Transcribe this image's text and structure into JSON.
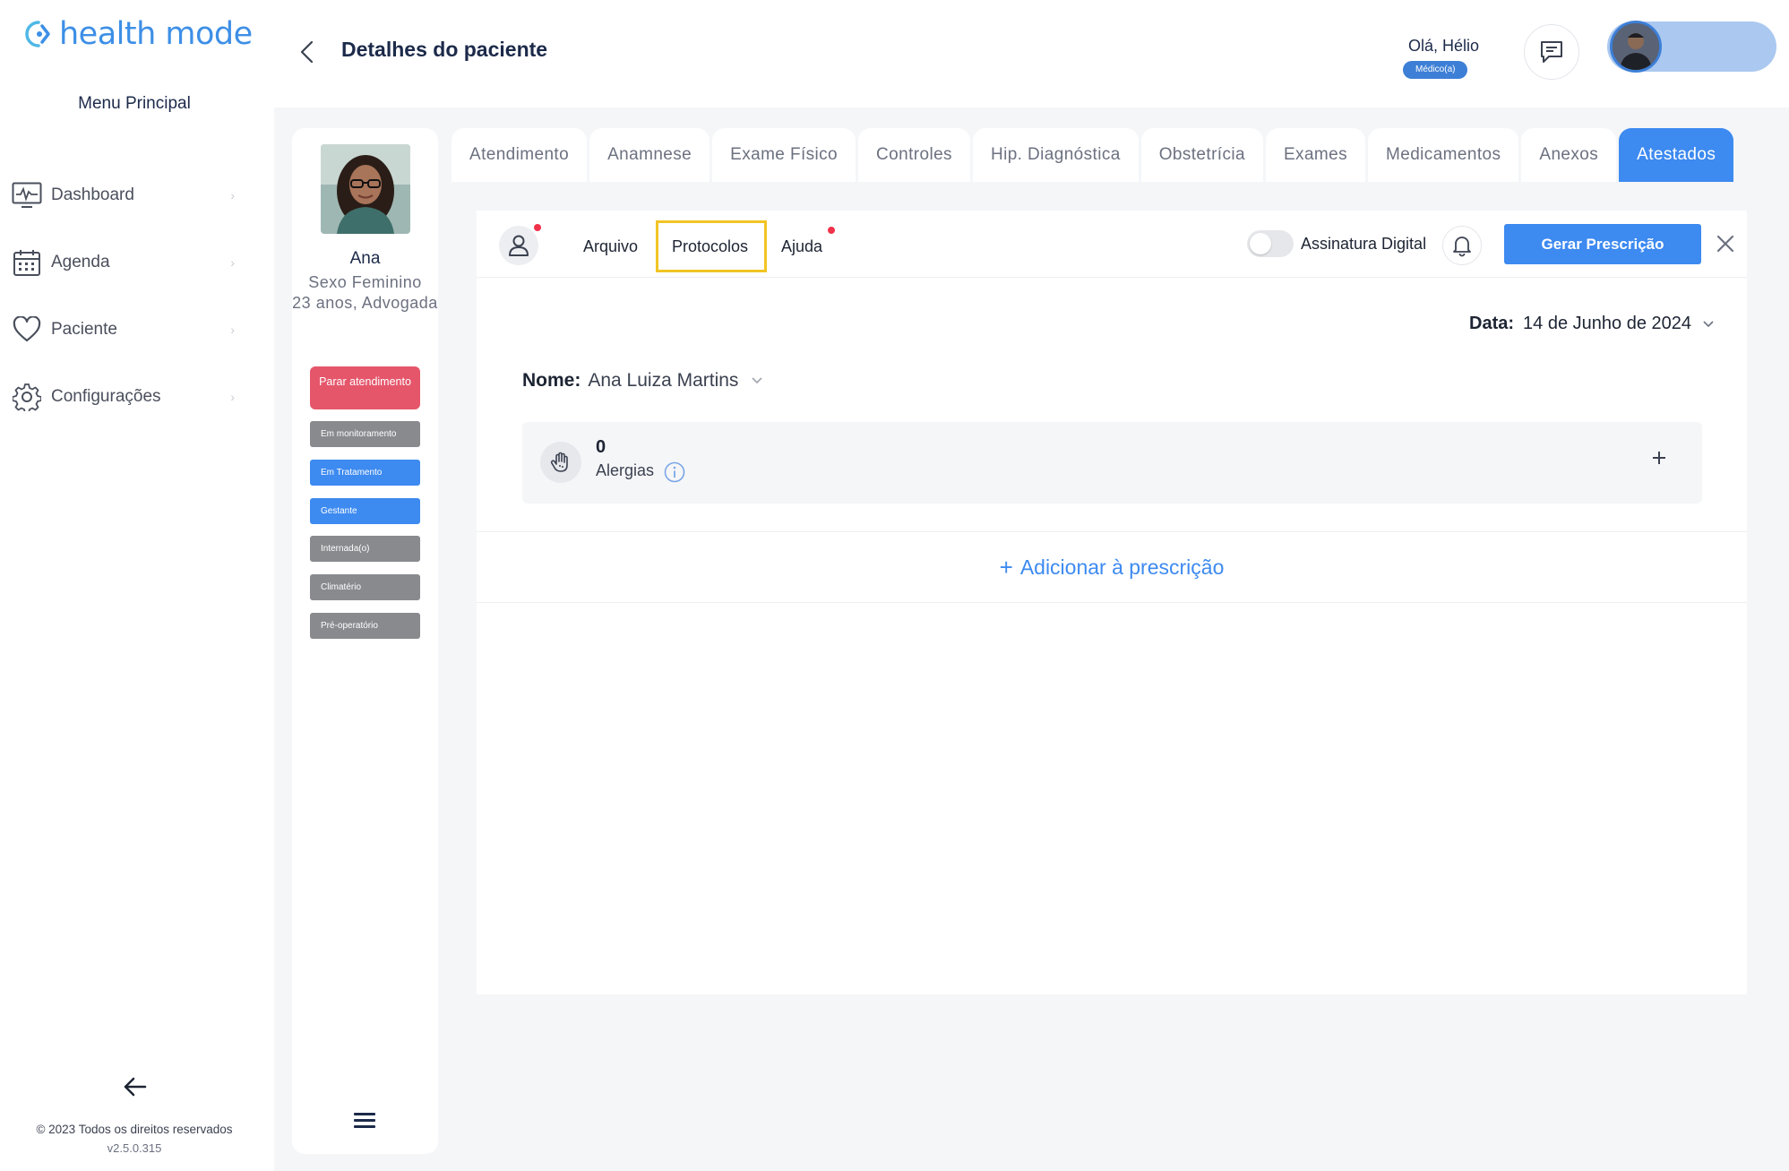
{
  "app": {
    "logo_text": "health mode",
    "menu_title": "Menu Principal"
  },
  "nav": {
    "items": [
      {
        "label": "Dashboard",
        "icon": "dashboard-monitor-icon"
      },
      {
        "label": "Agenda",
        "icon": "calendar-icon"
      },
      {
        "label": "Paciente",
        "icon": "heart-icon"
      },
      {
        "label": "Configurações",
        "icon": "gear-icon"
      }
    ],
    "collapse_icon": "arrow-left-icon"
  },
  "footer": {
    "copyright": "© 2023 Todos os direitos reservados",
    "version": "v2.5.0.315"
  },
  "header": {
    "title": "Detalhes do paciente",
    "user_greeting": "Olá, Hélio",
    "user_role": "Médico(a)"
  },
  "patient": {
    "name": "Ana",
    "sex": "Sexo Feminino",
    "age_occupation": "23 anos, Advogada",
    "stop_button": "Parar atendimento",
    "tags": [
      {
        "label": "Em monitoramento",
        "color": "#888a8e"
      },
      {
        "label": "Em Tratamento",
        "color": "#3d8af0"
      },
      {
        "label": "Gestante",
        "color": "#3d8af0"
      },
      {
        "label": "Internada(o)",
        "color": "#888a8e"
      },
      {
        "label": "Climatério",
        "color": "#888a8e"
      },
      {
        "label": "Pré-operatório",
        "color": "#888a8e"
      }
    ]
  },
  "tabs": [
    {
      "label": "Atendimento",
      "active": false
    },
    {
      "label": "Anamnese",
      "active": false
    },
    {
      "label": "Exame Físico",
      "active": false
    },
    {
      "label": "Controles",
      "active": false
    },
    {
      "label": "Hip. Diagnóstica",
      "active": false
    },
    {
      "label": "Obstetrícia",
      "active": false
    },
    {
      "label": "Exames",
      "active": false
    },
    {
      "label": "Medicamentos",
      "active": false
    },
    {
      "label": "Anexos",
      "active": false
    },
    {
      "label": "Atestados",
      "active": true
    }
  ],
  "prescription": {
    "menu": {
      "arquivo": "Arquivo",
      "protocolos": "Protocolos",
      "ajuda": "Ajuda"
    },
    "digital_signature_label": "Assinatura Digital",
    "digital_signature_on": false,
    "generate_button": "Gerar Prescrição",
    "date_label": "Data:",
    "date_value": "14 de Junho de 2024",
    "name_label": "Nome:",
    "name_value": "Ana Luiza Martins",
    "allergies": {
      "count": "0",
      "label": "Alergias"
    },
    "add_label": "Adicionar à prescrição"
  },
  "colors": {
    "accent": "#3d8af0",
    "danger": "#e5566b",
    "highlight": "#f2c425",
    "notification_dot": "#f0324a"
  }
}
